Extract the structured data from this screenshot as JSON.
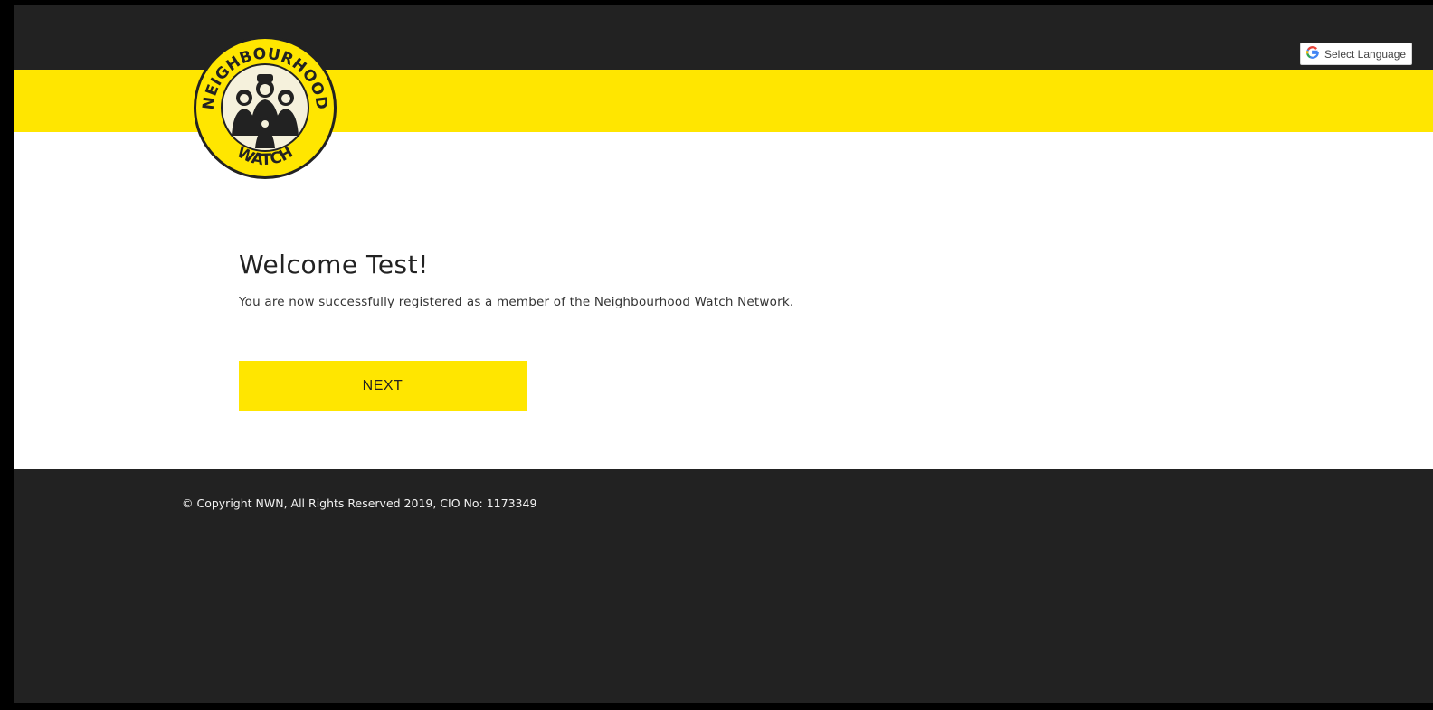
{
  "header": {
    "language_selector": {
      "icon": "google-g-icon",
      "label": "Select Language"
    },
    "logo": {
      "arc_top": "NEIGHBOURHOOD",
      "arc_bottom": "WATCH"
    }
  },
  "main": {
    "title": "Welcome Test!",
    "message": "You are now successfully registered as a member of the Neighbourhood Watch Network.",
    "next_button_label": "NEXT"
  },
  "footer": {
    "copyright": "© Copyright NWN, All Rights Reserved 2019, CIO No: 1173349"
  },
  "colors": {
    "brand_yellow": "#ffe600",
    "dark": "#222222",
    "google_blue": "#4285f4",
    "google_red": "#ea4335"
  }
}
